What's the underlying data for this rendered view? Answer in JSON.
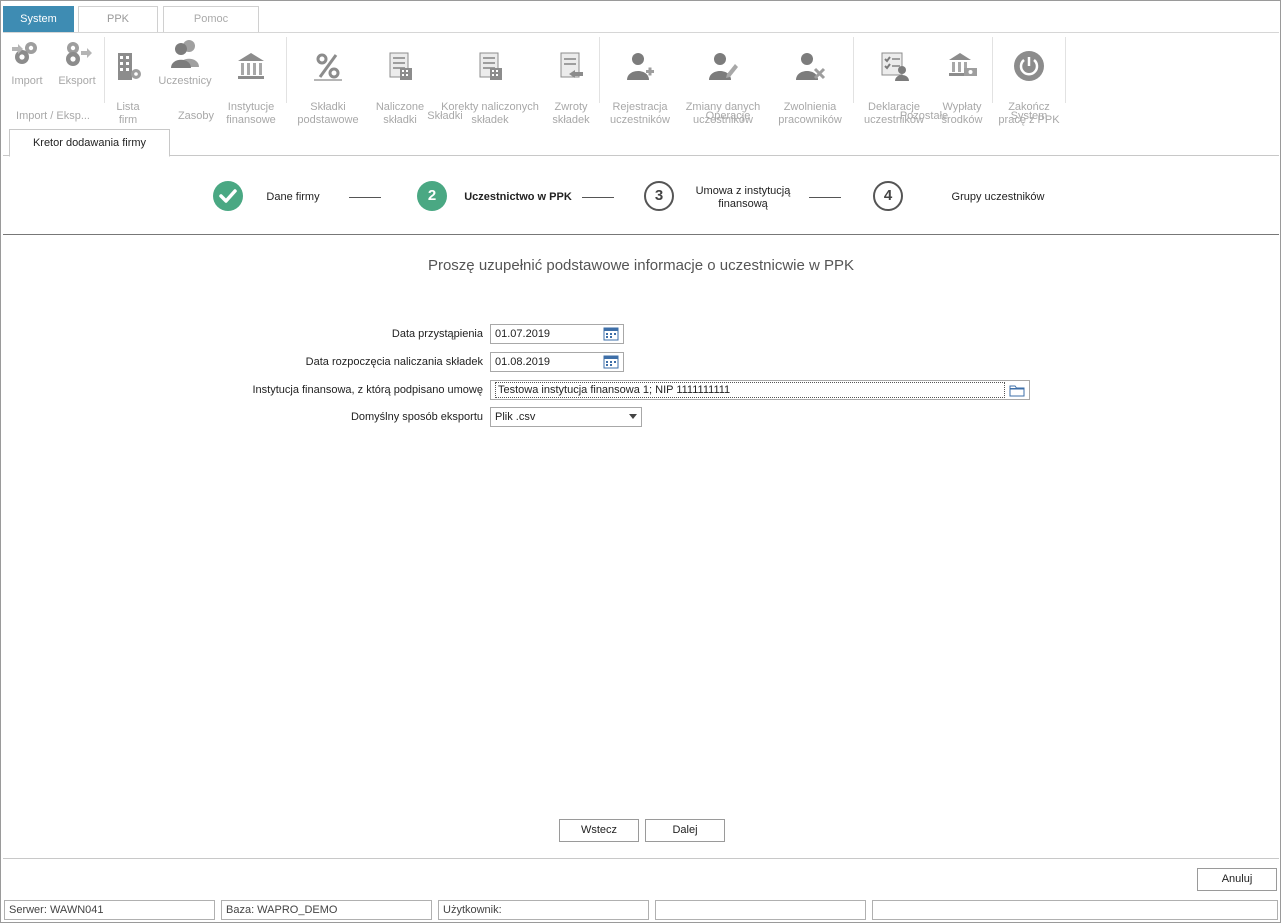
{
  "app_tabs": [
    "System",
    "PPK",
    "Pomoc"
  ],
  "ribbon": {
    "buttons": {
      "import": "Import",
      "eksport": "Eksport",
      "lista_firm": "Lista\nfirm",
      "uczestnicy": "Uczestnicy",
      "instytucje": "Instytucje\nfinansowe",
      "skladki_podstawowe": "Składki\npodstawowe",
      "naliczone_skladki": "Naliczone\nskładki",
      "korekty": "Korekty naliczonych\nskładek",
      "zwroty": "Zwroty\nskładek",
      "rejestracja": "Rejestracja\nuczestników",
      "zmiany": "Zmiany danych\nuczestników",
      "zwolnienia": "Zwolnienia\npracowników",
      "deklaracje": "Deklaracje\nuczestników",
      "wyplaty": "Wypłaty\nśrodków",
      "zakoncz": "Zakończ\npracę z PPK"
    },
    "groups": {
      "import": "Import / Eksp...",
      "zasoby": "Zasoby",
      "skladki": "Składki",
      "operacje": "Operacje",
      "pozostale": "Pozostałe",
      "system": "System"
    }
  },
  "doc_tab": "Kretor dodawania firmy",
  "steps": [
    {
      "num": "",
      "label": "Dane firmy"
    },
    {
      "num": "2",
      "label": "Uczestnictwo w PPK"
    },
    {
      "num": "3",
      "label": "Umowa z instytucją\nfinansową"
    },
    {
      "num": "4",
      "label": "Grupy uczestników"
    }
  ],
  "headline": "Proszę uzupełnić podstawowe informacje o uczestnicwie w PPK",
  "form": {
    "data_przystapienia": {
      "label": "Data przystąpienia",
      "value": "01.07.2019"
    },
    "data_rozpoczecia": {
      "label": "Data rozpoczęcia naliczania składek",
      "value": "01.08.2019"
    },
    "instytucja": {
      "label": "Instytucja finansowa, z którą podpisano umowę",
      "value": "Testowa instytucja finansowa 1; NIP 1111111111"
    },
    "eksport": {
      "label": "Domyślny sposób eksportu",
      "value": "Plik .csv"
    }
  },
  "buttons": {
    "wstecz": "Wstecz",
    "dalej": "Dalej",
    "anuluj": "Anuluj"
  },
  "status": {
    "serwer": "Serwer: WAWN041",
    "baza": "Baza: WAPRO_DEMO",
    "uzytkownik": "Użytkownik:",
    "empty1": "",
    "empty2": ""
  },
  "colors": {
    "accent": "#3e8cb3",
    "step_green": "#4aa883"
  }
}
